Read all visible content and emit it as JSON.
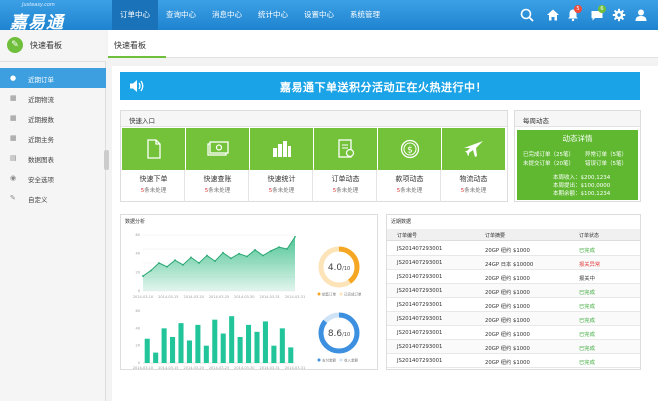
{
  "header": {
    "logo_site": "Justeasy.com",
    "logo_name": "嘉易通",
    "nav": [
      "订单中心",
      "查询中心",
      "消息中心",
      "统计中心",
      "设置中心",
      "系统管理"
    ],
    "active_nav": 0,
    "notif_count": "5",
    "message_count": "6"
  },
  "sidebar": {
    "title": "快速看板",
    "items": [
      {
        "label": "近期订单",
        "icon": "user-icon"
      },
      {
        "label": "近期物流",
        "icon": "calendar-icon"
      },
      {
        "label": "近期报数",
        "icon": "calendar-icon"
      },
      {
        "label": "近期主务",
        "icon": "calendar-icon"
      },
      {
        "label": "数据图表",
        "icon": "chart-icon"
      },
      {
        "label": "安全选项",
        "icon": "lock-icon"
      },
      {
        "label": "自定义",
        "icon": "pencil-icon"
      }
    ]
  },
  "main": {
    "tab": "快速看板",
    "banner": "嘉易通下单送积分活动正在火热进行中！",
    "quick_title": "快速入口",
    "quick_items": [
      {
        "label": "快速下单",
        "count": "5",
        "suffix": "条未处理",
        "icon": "document-icon"
      },
      {
        "label": "快速查账",
        "count": "5",
        "suffix": "条未处理",
        "icon": "money-icon"
      },
      {
        "label": "快速统计",
        "count": "5",
        "suffix": "条未处理",
        "icon": "stats-icon"
      },
      {
        "label": "订单动态",
        "count": "5",
        "suffix": "条未处理",
        "icon": "order-icon"
      },
      {
        "label": "款项动态",
        "count": "5",
        "suffix": "条未处理",
        "icon": "dollar-icon"
      },
      {
        "label": "物流动态",
        "count": "5",
        "suffix": "条未处理",
        "icon": "plane-icon"
      }
    ],
    "weekly": {
      "title": "每周动态",
      "detail_title": "动态详情",
      "rows": [
        [
          "已完成订单（25笔）",
          "异常订单（5笔）"
        ],
        [
          "未提交订单（20笔）",
          "错误订单（5笔）"
        ]
      ],
      "income_label": "本周收入：",
      "income": "$200,1234",
      "out_label": "本周提出：",
      "out": "$100,0000",
      "balance_label": "本期余额：",
      "balance": "$100,1234"
    },
    "chart_title": "数据分析",
    "table_title": "近期数据",
    "table_headers": [
      "订单编号",
      "订单摘要",
      "订单状态"
    ],
    "table_rows": [
      {
        "id": "JS20140729300​1",
        "summary": "20GP  纽约  $1000",
        "status": "已完成",
        "status_color": "#3aa83a"
      },
      {
        "id": "JS201407293001",
        "summary": "24GP  日本  $10000",
        "status": "报关异常",
        "status_color": "#e03a3a"
      },
      {
        "id": "JS201407293001",
        "summary": "20GP  纽约  $1000",
        "status": "报关中",
        "status_color": "#333333"
      },
      {
        "id": "JS201407293001",
        "summary": "20GP  纽约  $1000",
        "status": "已完成",
        "status_color": "#3aa83a"
      },
      {
        "id": "JS201407293001",
        "summary": "20GP  纽约  $1000",
        "status": "已完成",
        "status_color": "#3aa83a"
      },
      {
        "id": "JS201407293001",
        "summary": "20GP  纽约  $1000",
        "status": "已完成",
        "status_color": "#3aa83a"
      },
      {
        "id": "JS201407293001",
        "summary": "20GP  纽约  $1000",
        "status": "已完成",
        "status_color": "#3aa83a"
      },
      {
        "id": "JS201407293001",
        "summary": "20GP  纽约  $1000",
        "status": "已完成",
        "status_color": "#3aa83a"
      },
      {
        "id": "JS201407293001",
        "summary": "20GP  纽约  $1000",
        "status": "已完成",
        "status_color": "#3aa83a"
      }
    ]
  },
  "chart_data": [
    {
      "type": "area",
      "categories": [
        "2014-03-10",
        "2014-03-15",
        "2014-03-20",
        "2014-03-25",
        "2014-03-30",
        "2014-03-31",
        "2014-03-31"
      ],
      "values": [
        16,
        22,
        30,
        26,
        33,
        28,
        36,
        30,
        38,
        32,
        41,
        35,
        40,
        37,
        44,
        38,
        43,
        47,
        45,
        58
      ],
      "ylabel": "",
      "ylim": [
        0,
        60
      ],
      "color": "#3dbf8a"
    },
    {
      "type": "bar",
      "categories": [
        "2014-03-10",
        "2014-03-15",
        "2014-03-20",
        "2014-03-25",
        "2014-03-30",
        "2014-03-31",
        "2014-03-31"
      ],
      "values": [
        28,
        12,
        40,
        30,
        46,
        26,
        44,
        20,
        50,
        34,
        54,
        30,
        44,
        36,
        48,
        20,
        40,
        18
      ],
      "ylim": [
        0,
        60
      ],
      "color": "#22c59a"
    },
    {
      "type": "pie",
      "values": [
        4.0,
        6.0
      ],
      "center_label": "4.0",
      "center_suffix": "/10",
      "colors": [
        "#f5a623",
        "#fde3b8"
      ],
      "legend": [
        "销售订单",
        "已完成订单"
      ]
    },
    {
      "type": "pie",
      "values": [
        8.6,
        1.4
      ],
      "center_label": "8.6",
      "center_suffix": "/10",
      "colors": [
        "#3d8fe0",
        "#cfe3f7"
      ],
      "legend": [
        "支付金额",
        "收入金额"
      ]
    }
  ]
}
